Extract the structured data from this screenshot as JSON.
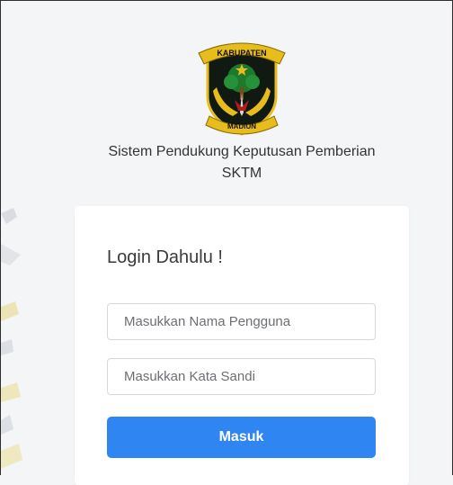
{
  "logo": {
    "banner_top": "KABUPATEN",
    "banner_bottom": "MADIUN",
    "colors": {
      "shield": "#111a12",
      "gold": "#e6bd1c",
      "green": "#1d7a2c"
    }
  },
  "app_title": {
    "line1": "Sistem Pendukung Keputusan Pemberian",
    "line2": "SKTM"
  },
  "login": {
    "heading": "Login Dahulu !",
    "username_placeholder": "Masukkan Nama Pengguna",
    "password_placeholder": "Masukkan Kata Sandi",
    "submit_label": "Masuk"
  },
  "theme": {
    "background": "#f4f5f7",
    "card": "#ffffff",
    "button": "#2f86f2"
  }
}
